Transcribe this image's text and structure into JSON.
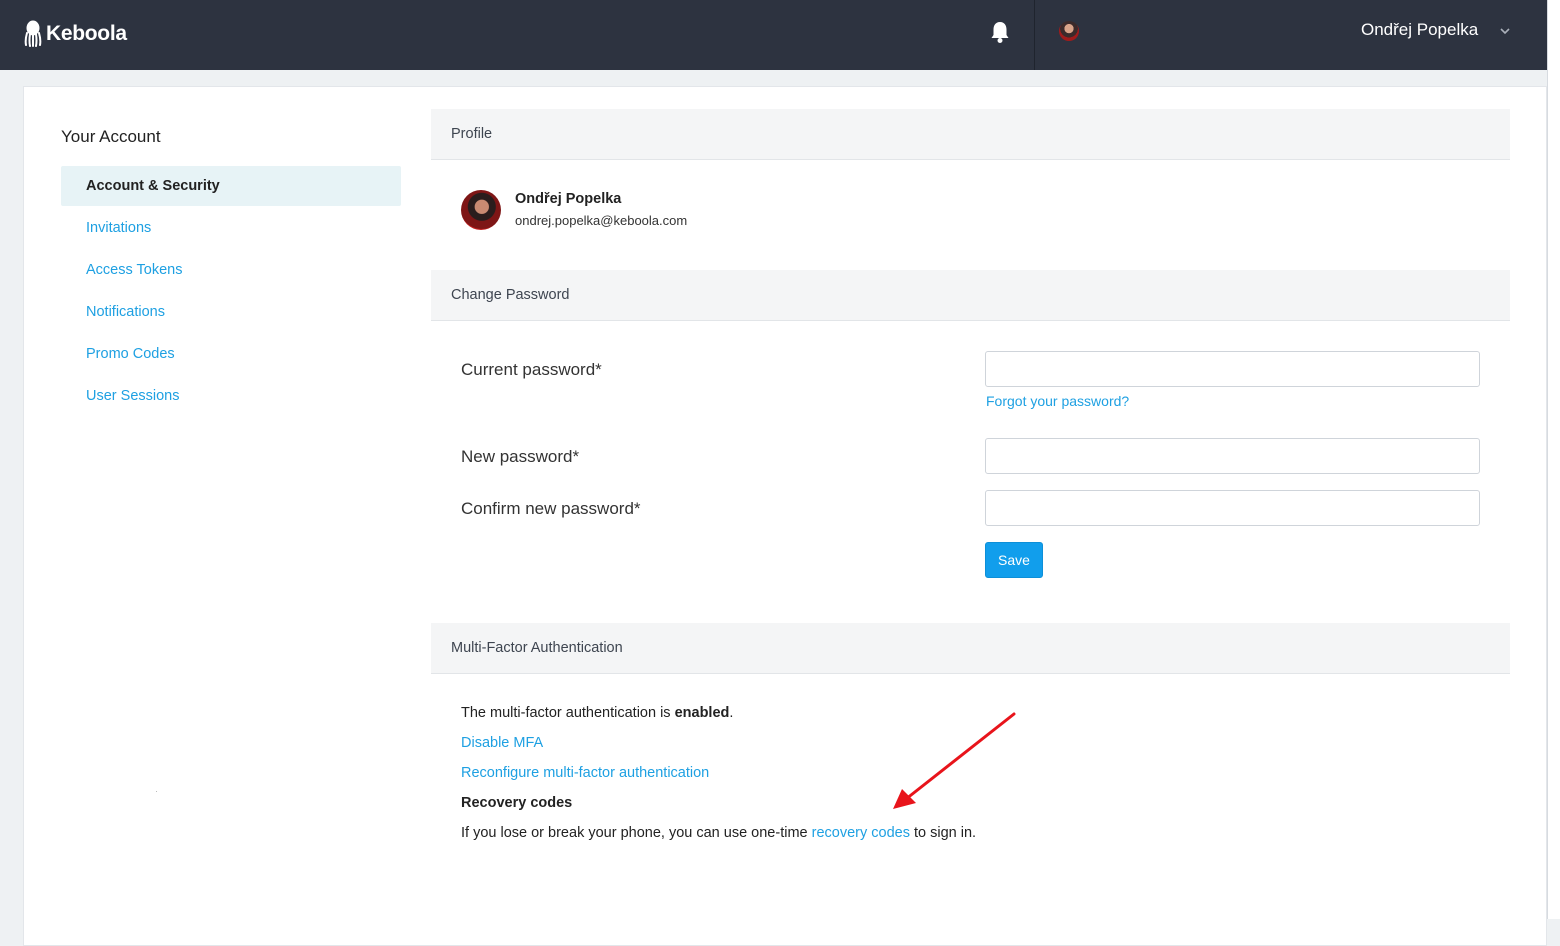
{
  "app": {
    "logo_text": "Keboola",
    "user_name": "Ondřej Popelka"
  },
  "sidebar": {
    "title": "Your Account",
    "items": [
      {
        "label": "Account & Security",
        "active": true
      },
      {
        "label": "Invitations"
      },
      {
        "label": "Access Tokens"
      },
      {
        "label": "Notifications"
      },
      {
        "label": "Promo Codes"
      },
      {
        "label": "User Sessions"
      }
    ]
  },
  "profile": {
    "header": "Profile",
    "name": "Ondřej Popelka",
    "email": "ondrej.popelka@keboola.com"
  },
  "password": {
    "header": "Change Password",
    "current_label": "Current password*",
    "current_value": "",
    "forgot_link": "Forgot your password?",
    "new_label": "New password*",
    "new_value": "",
    "confirm_label": "Confirm new password*",
    "confirm_value": "",
    "save_label": "Save"
  },
  "mfa": {
    "header": "Multi-Factor Authentication",
    "status_prefix": "The multi-factor authentication is ",
    "status_value": "enabled",
    "status_suffix": ".",
    "disable_link": "Disable MFA",
    "reconfigure_link": "Reconfigure multi-factor authentication",
    "recovery_title": "Recovery codes",
    "recovery_prefix": "If you lose or break your phone, you can use one-time ",
    "recovery_link": "recovery codes",
    "recovery_suffix": " to sign in."
  },
  "colors": {
    "topbar": "#2d3340",
    "link": "#1ea0e2",
    "primary_button": "#119eec",
    "annotation_arrow": "#e8141b"
  },
  "icons": {
    "logo": "keboola-octopus-icon",
    "notifications": "bell-icon",
    "user_menu": "chevron-down-icon"
  }
}
